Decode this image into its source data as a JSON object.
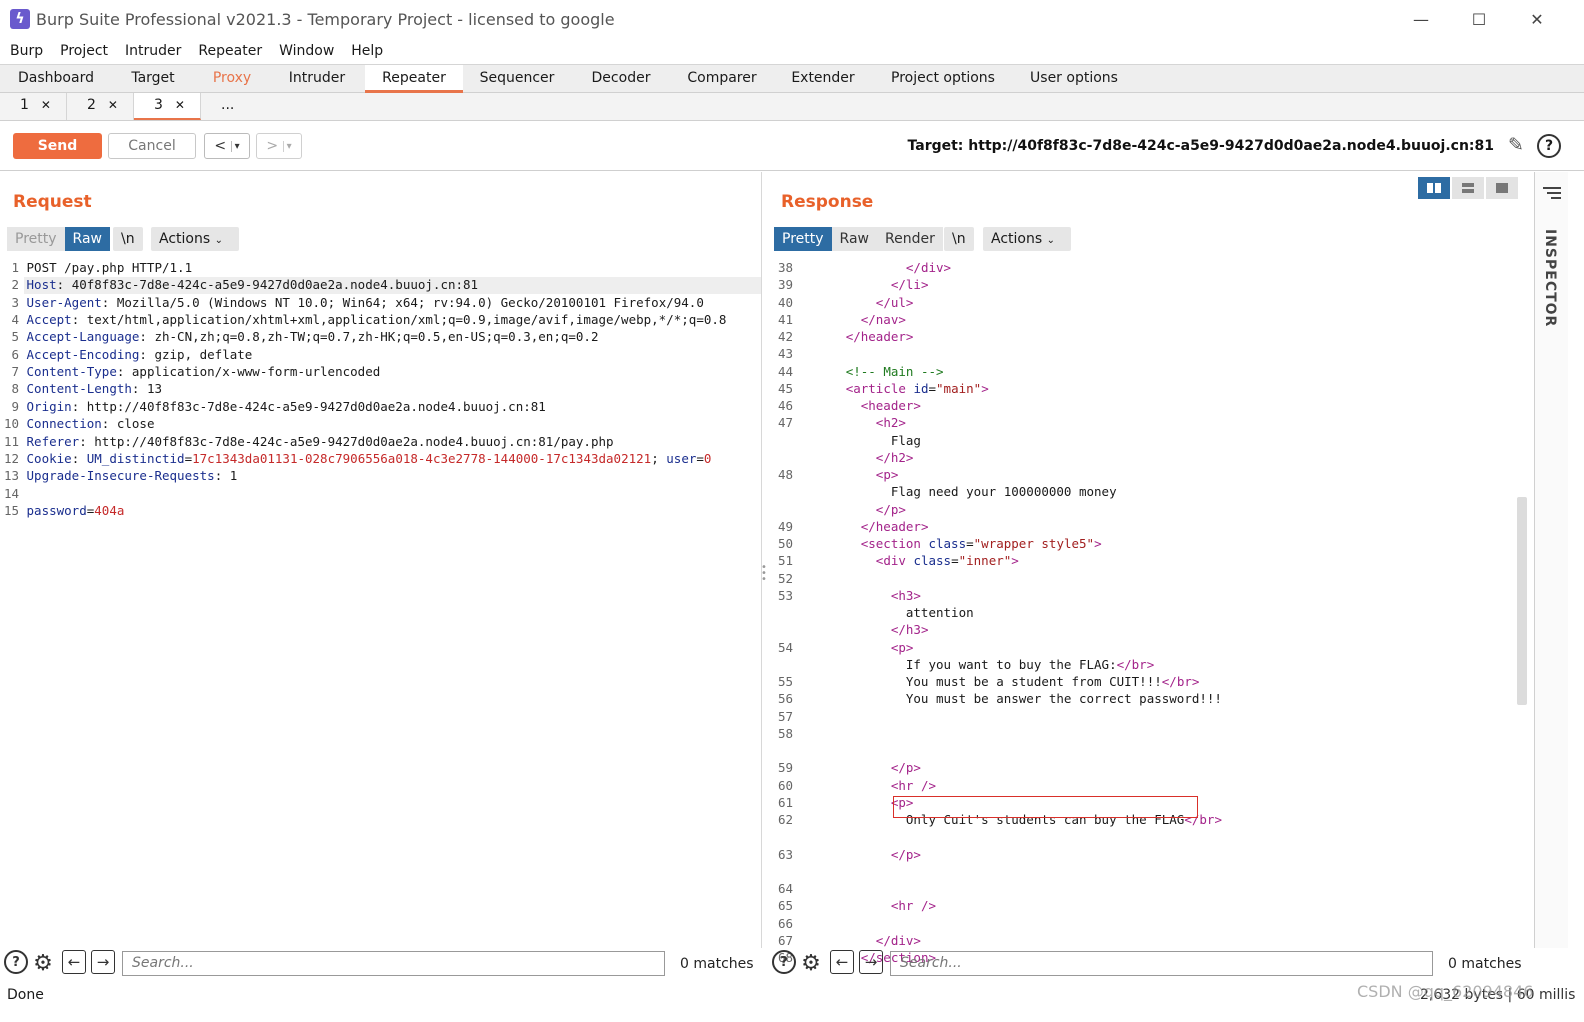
{
  "window": {
    "title": "Burp Suite Professional v2021.3 - Temporary Project - licensed to google",
    "app_icon": "burp-bolt-icon"
  },
  "menu": [
    "Burp",
    "Project",
    "Intruder",
    "Repeater",
    "Window",
    "Help"
  ],
  "main_tabs": [
    "Dashboard",
    "Target",
    "Proxy",
    "Intruder",
    "Repeater",
    "Sequencer",
    "Decoder",
    "Comparer",
    "Extender",
    "Project options",
    "User options"
  ],
  "active_main_tab": "Repeater",
  "sub_tabs": [
    "1",
    "2",
    "3",
    "..."
  ],
  "active_sub_tab": "3",
  "toolbar": {
    "send": "Send",
    "cancel": "Cancel",
    "back": "<",
    "forward": ">",
    "dropdown": "▾",
    "target": "Target: http://40f8f83c-7d8e-424c-a5e9-9427d0d0ae2a.node4.buuoj.cn:81"
  },
  "request": {
    "title": "Request",
    "modes": [
      "Pretty",
      "Raw"
    ],
    "selected_mode": "Raw",
    "newline_btn": "\\n",
    "actions": "Actions",
    "lines": [
      {
        "n": "1",
        "key": "",
        "sep": "",
        "val": "POST /pay.php HTTP/1.1"
      },
      {
        "n": "2",
        "key": "Host",
        "sep": ": ",
        "val": "40f8f83c-7d8e-424c-a5e9-9427d0d0ae2a.node4.buuoj.cn:81"
      },
      {
        "n": "3",
        "key": "User-Agent",
        "sep": ": ",
        "val": "Mozilla/5.0 (Windows NT 10.0; Win64; x64; rv:94.0) Gecko/20100101 Firefox/94.0"
      },
      {
        "n": "4",
        "key": "Accept",
        "sep": ": ",
        "val": "text/html,application/xhtml+xml,application/xml;q=0.9,image/avif,image/webp,*/*;q=0.8"
      },
      {
        "n": "5",
        "key": "Accept-Language",
        "sep": ": ",
        "val": "zh-CN,zh;q=0.8,zh-TW;q=0.7,zh-HK;q=0.5,en-US;q=0.3,en;q=0.2"
      },
      {
        "n": "6",
        "key": "Accept-Encoding",
        "sep": ": ",
        "val": "gzip, deflate"
      },
      {
        "n": "7",
        "key": "Content-Type",
        "sep": ": ",
        "val": "application/x-www-form-urlencoded"
      },
      {
        "n": "8",
        "key": "Content-Length",
        "sep": ": ",
        "val": "13"
      },
      {
        "n": "9",
        "key": "Origin",
        "sep": ": ",
        "val": "http://40f8f83c-7d8e-424c-a5e9-9427d0d0ae2a.node4.buuoj.cn:81"
      },
      {
        "n": "10",
        "key": "Connection",
        "sep": ": ",
        "val": "close"
      },
      {
        "n": "11",
        "key": "Referer",
        "sep": ": ",
        "val": "http://40f8f83c-7d8e-424c-a5e9-9427d0d0ae2a.node4.buuoj.cn:81/pay.php"
      },
      {
        "n": "12",
        "key": "Cookie",
        "sep": ": ",
        "val": "",
        "cookie": true
      },
      {
        "n": "13",
        "key": "Upgrade-Insecure-Requests",
        "sep": ": ",
        "val": "1"
      },
      {
        "n": "14",
        "key": "",
        "sep": "",
        "val": ""
      },
      {
        "n": "15",
        "key": "password",
        "sep": "=",
        "val": "404a",
        "param": true
      }
    ],
    "cookie": {
      "name1": "UM_distinctid",
      "value1": "17c1343da01131-028c7906556a018-4c3e2778-144000-17c1343da02121",
      "name2": "user",
      "value2": "0"
    }
  },
  "response": {
    "title": "Response",
    "modes": [
      "Pretty",
      "Raw",
      "Render"
    ],
    "selected_mode": "Pretty",
    "newline_btn": "\\n",
    "actions": "Actions",
    "lines": [
      {
        "n": "38",
        "html": "          <span class='k-tag'>&lt;/div&gt;</span>"
      },
      {
        "n": "39",
        "html": "        <span class='k-tag'>&lt;/li&gt;</span>"
      },
      {
        "n": "40",
        "html": "      <span class='k-tag'>&lt;/ul&gt;</span>"
      },
      {
        "n": "41",
        "html": "    <span class='k-tag'>&lt;/nav&gt;</span>"
      },
      {
        "n": "42",
        "html": "  <span class='k-tag'>&lt;/header&gt;</span>"
      },
      {
        "n": "43",
        "html": ""
      },
      {
        "n": "44",
        "html": "  <span class='k-com'>&lt;!-- Main --&gt;</span>"
      },
      {
        "n": "45",
        "html": "  <span class='k-tag'>&lt;article</span> <span class='k-attr'>id</span>=<span class='k-str'>\"main\"</span><span class='k-tag'>&gt;</span>"
      },
      {
        "n": "46",
        "html": "    <span class='k-tag'>&lt;header&gt;</span>"
      },
      {
        "n": "47",
        "html": "      <span class='k-tag'>&lt;h2&gt;</span>"
      },
      {
        "n": "",
        "html": "        Flag"
      },
      {
        "n": "",
        "html": "      <span class='k-tag'>&lt;/h2&gt;</span>"
      },
      {
        "n": "48",
        "html": "      <span class='k-tag'>&lt;p&gt;</span>"
      },
      {
        "n": "",
        "html": "        Flag need your 100000000 money"
      },
      {
        "n": "",
        "html": "      <span class='k-tag'>&lt;/p&gt;</span>"
      },
      {
        "n": "49",
        "html": "    <span class='k-tag'>&lt;/header&gt;</span>"
      },
      {
        "n": "50",
        "html": "    <span class='k-tag'>&lt;section</span> <span class='k-attr'>class</span>=<span class='k-str'>\"wrapper style5\"</span><span class='k-tag'>&gt;</span>"
      },
      {
        "n": "51",
        "html": "      <span class='k-tag'>&lt;div</span> <span class='k-attr'>class</span>=<span class='k-str'>\"inner\"</span><span class='k-tag'>&gt;</span>"
      },
      {
        "n": "52",
        "html": ""
      },
      {
        "n": "53",
        "html": "        <span class='k-tag'>&lt;h3&gt;</span>"
      },
      {
        "n": "",
        "html": "          attention"
      },
      {
        "n": "",
        "html": "        <span class='k-tag'>&lt;/h3&gt;</span>"
      },
      {
        "n": "54",
        "html": "        <span class='k-tag'>&lt;p&gt;</span>"
      },
      {
        "n": "",
        "html": "          If you want to buy the FLAG:<span class='k-tag'>&lt;/br&gt;</span>"
      },
      {
        "n": "55",
        "html": "          You must be a student from CUIT!!!<span class='k-tag'>&lt;/br&gt;</span>"
      },
      {
        "n": "56",
        "html": "          You must be answer the correct password!!!"
      },
      {
        "n": "57",
        "html": ""
      },
      {
        "n": "58",
        "html": ""
      },
      {
        "n": "",
        "html": ""
      },
      {
        "n": "59",
        "html": "        <span class='k-tag'>&lt;/p&gt;</span>"
      },
      {
        "n": "60",
        "html": "        <span class='k-tag'>&lt;hr /&gt;</span>"
      },
      {
        "n": "61",
        "html": "        <span class='k-tag'>&lt;p&gt;</span>"
      },
      {
        "n": "62",
        "html": "          Only Cuit's students can buy the FLAG<span class='k-tag'>&lt;/br&gt;</span>"
      },
      {
        "n": "",
        "html": ""
      },
      {
        "n": "63",
        "html": "        <span class='k-tag'>&lt;/p&gt;</span>"
      },
      {
        "n": "",
        "html": ""
      },
      {
        "n": "64",
        "html": ""
      },
      {
        "n": "65",
        "html": "        <span class='k-tag'>&lt;hr /&gt;</span>"
      },
      {
        "n": "66",
        "html": ""
      },
      {
        "n": "67",
        "html": "      <span class='k-tag'>&lt;/div&gt;</span>"
      },
      {
        "n": "68",
        "html": "    <span class='k-tag'>&lt;/section&gt;</span>"
      }
    ]
  },
  "search": {
    "placeholder": "Search...",
    "matches": "0 matches"
  },
  "inspector": "INSPECTOR",
  "status": {
    "left": "Done",
    "right": "2,632 bytes | 60 millis"
  },
  "watermark": "CSDN @qq_62094846"
}
